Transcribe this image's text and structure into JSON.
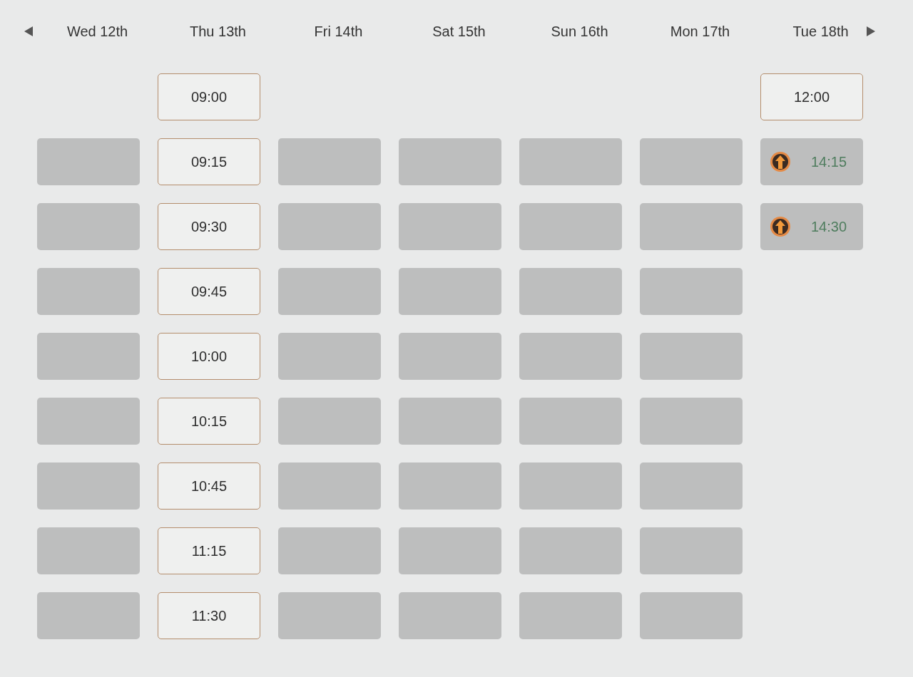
{
  "days": [
    {
      "label": "Wed 12th",
      "slots": [
        {
          "kind": "empty"
        },
        {
          "kind": "blocked"
        },
        {
          "kind": "blocked"
        },
        {
          "kind": "blocked"
        },
        {
          "kind": "blocked"
        },
        {
          "kind": "blocked"
        },
        {
          "kind": "blocked"
        },
        {
          "kind": "blocked"
        },
        {
          "kind": "blocked"
        }
      ]
    },
    {
      "label": "Thu 13th",
      "slots": [
        {
          "kind": "open",
          "time": "09:00"
        },
        {
          "kind": "open",
          "time": "09:15"
        },
        {
          "kind": "open",
          "time": "09:30"
        },
        {
          "kind": "open",
          "time": "09:45"
        },
        {
          "kind": "open",
          "time": "10:00"
        },
        {
          "kind": "open",
          "time": "10:15"
        },
        {
          "kind": "open",
          "time": "10:45"
        },
        {
          "kind": "open",
          "time": "11:15"
        },
        {
          "kind": "open",
          "time": "11:30"
        }
      ]
    },
    {
      "label": "Fri 14th",
      "slots": [
        {
          "kind": "empty"
        },
        {
          "kind": "blocked"
        },
        {
          "kind": "blocked"
        },
        {
          "kind": "blocked"
        },
        {
          "kind": "blocked"
        },
        {
          "kind": "blocked"
        },
        {
          "kind": "blocked"
        },
        {
          "kind": "blocked"
        },
        {
          "kind": "blocked"
        }
      ]
    },
    {
      "label": "Sat 15th",
      "slots": [
        {
          "kind": "empty"
        },
        {
          "kind": "blocked"
        },
        {
          "kind": "blocked"
        },
        {
          "kind": "blocked"
        },
        {
          "kind": "blocked"
        },
        {
          "kind": "blocked"
        },
        {
          "kind": "blocked"
        },
        {
          "kind": "blocked"
        },
        {
          "kind": "blocked"
        }
      ]
    },
    {
      "label": "Sun 16th",
      "slots": [
        {
          "kind": "empty"
        },
        {
          "kind": "blocked"
        },
        {
          "kind": "blocked"
        },
        {
          "kind": "blocked"
        },
        {
          "kind": "blocked"
        },
        {
          "kind": "blocked"
        },
        {
          "kind": "blocked"
        },
        {
          "kind": "blocked"
        },
        {
          "kind": "blocked"
        }
      ]
    },
    {
      "label": "Mon 17th",
      "slots": [
        {
          "kind": "empty"
        },
        {
          "kind": "blocked"
        },
        {
          "kind": "blocked"
        },
        {
          "kind": "blocked"
        },
        {
          "kind": "blocked"
        },
        {
          "kind": "blocked"
        },
        {
          "kind": "blocked"
        },
        {
          "kind": "blocked"
        },
        {
          "kind": "blocked"
        }
      ]
    },
    {
      "label": "Tue 18th",
      "slots": [
        {
          "kind": "open",
          "time": "12:00"
        },
        {
          "kind": "pending",
          "time": "14:15"
        },
        {
          "kind": "pending",
          "time": "14:30"
        }
      ]
    }
  ]
}
